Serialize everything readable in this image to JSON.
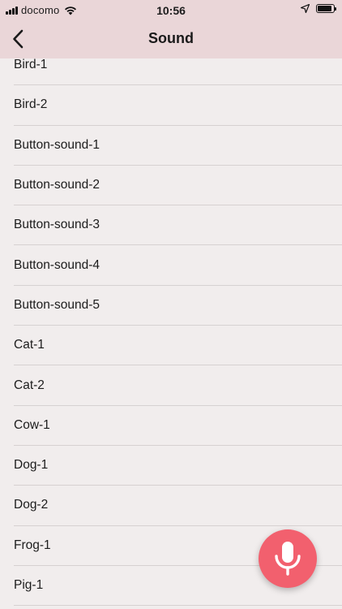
{
  "status_bar": {
    "carrier": "docomo",
    "time": "10:56",
    "battery_level": 0.9
  },
  "nav": {
    "title": "Sound",
    "back_icon": "chevron-left-icon"
  },
  "sounds": [
    "Bird-1",
    "Bird-2",
    "Button-sound-1",
    "Button-sound-2",
    "Button-sound-3",
    "Button-sound-4",
    "Button-sound-5",
    "Cat-1",
    "Cat-2",
    "Cow-1",
    "Dog-1",
    "Dog-2",
    "Frog-1",
    "Pig-1"
  ],
  "mic_button": {
    "icon": "microphone-icon",
    "color": "#f2606e"
  }
}
